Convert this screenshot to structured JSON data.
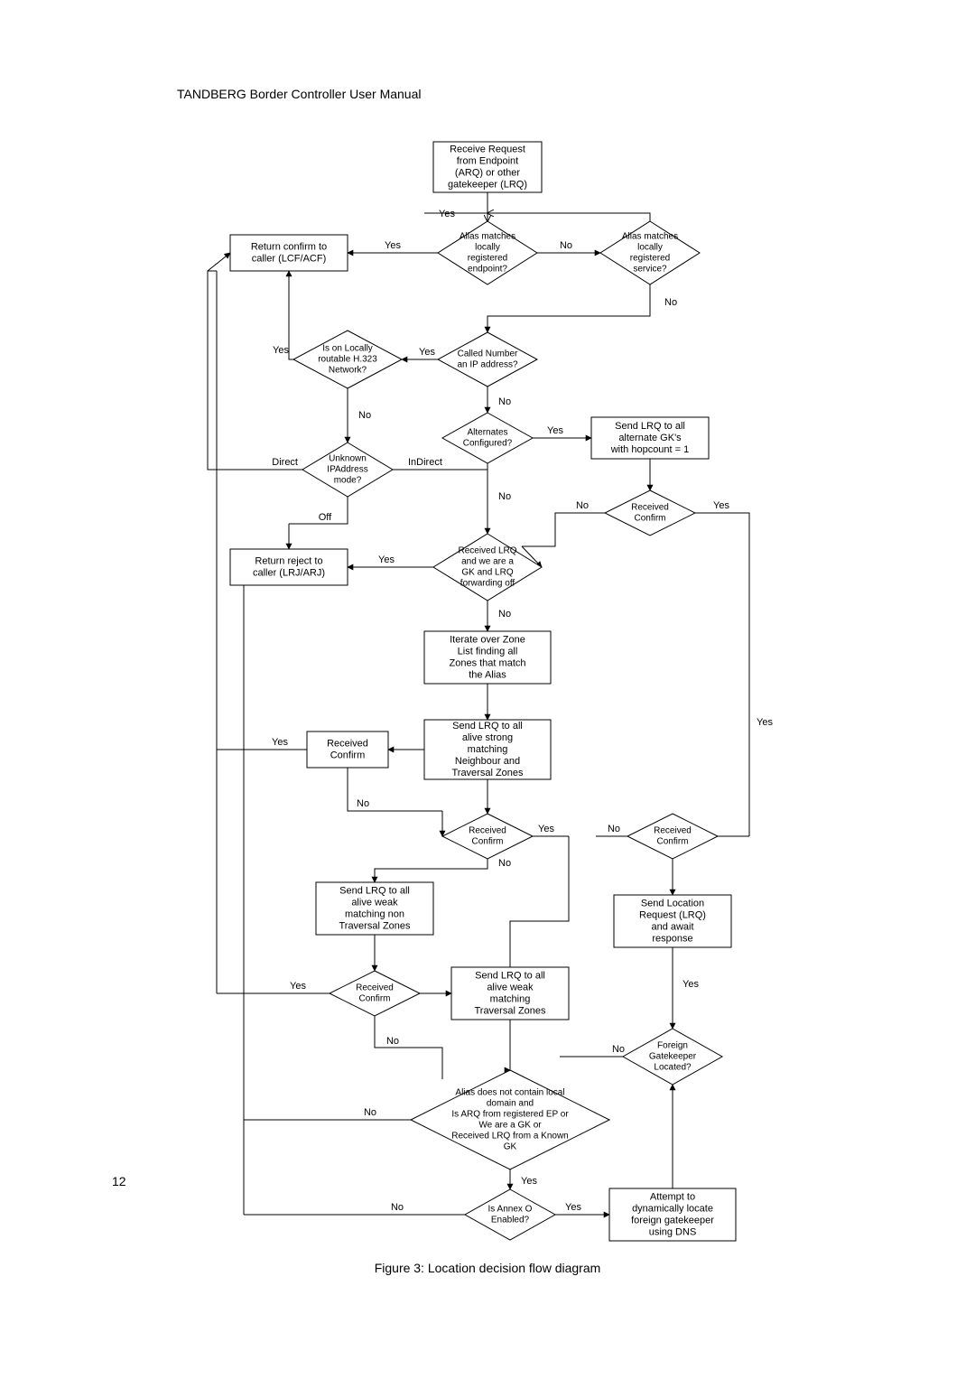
{
  "header": "TANDBERG Border Controller User Manual",
  "page_number": "12",
  "caption": "Figure 3: Location decision flow diagram",
  "labels": {
    "yes": "Yes",
    "no": "No",
    "off": "Off",
    "direct": "Direct",
    "indirect": "InDirect"
  },
  "nodes": {
    "start": [
      "Receive Request",
      "from Endpoint",
      "(ARQ) or other",
      "gatekeeper (LRQ)"
    ],
    "alias_local_ep": [
      "Alias matches",
      "locally",
      "registered",
      "endpoint?"
    ],
    "alias_local_svc": [
      "Alias matches",
      "locally",
      "registered",
      "service?"
    ],
    "return_confirm": [
      "Return confirm to",
      "caller (LCF/ACF)"
    ],
    "called_ip": [
      "Called Number",
      "an IP address?"
    ],
    "routable_net": [
      "Is on Locally",
      "routable H.323",
      "Network?"
    ],
    "alternates_cfg": [
      "Alternates",
      "Configured?"
    ],
    "send_alt": [
      "Send LRQ to all",
      "alternate GK's",
      "with hopcount = 1"
    ],
    "unknown_ip_mode": [
      "Unknown",
      "IPAddress",
      "mode?"
    ],
    "recv_confirm_alt": [
      "Received",
      "Confirm"
    ],
    "recv_lrq_gk": [
      "Received LRQ",
      "and we are a",
      "GK and LRQ",
      "forwarding off"
    ],
    "return_reject": [
      "Return reject to",
      "caller (LRJ/ARJ)"
    ],
    "iterate_zones": [
      "Iterate over Zone",
      "List finding all",
      "Zones that match",
      "the Alias"
    ],
    "send_strong": [
      "Send LRQ to all",
      "alive strong",
      "matching",
      "Neighbour and",
      "Traversal Zones"
    ],
    "recv_confirm_strong": [
      "Received",
      "Confirm"
    ],
    "recv_confirm_mid": [
      "Received",
      "Confirm"
    ],
    "send_weak_non_trav": [
      "Send LRQ to all",
      "alive weak",
      "matching non",
      "Traversal Zones"
    ],
    "recv_confirm_weak": [
      "Received",
      "Confirm"
    ],
    "send_weak_trav": [
      "Send LRQ to all",
      "alive weak",
      "matching",
      "Traversal Zones"
    ],
    "recv_confirm_right": [
      "Received",
      "Confirm"
    ],
    "send_loc_req": [
      "Send Location",
      "Request (LRQ)",
      "and await",
      "response"
    ],
    "foreign_gk": [
      "Foreign",
      "Gatekeeper",
      "Located?"
    ],
    "arq_check": [
      "Alias does not contain local",
      "domain and",
      "Is ARQ from registered EP or",
      "We are a GK or",
      "Received LRQ from a Known",
      "GK"
    ],
    "annex_o": [
      "Is Annex O",
      "Enabled?"
    ],
    "attempt_dns": [
      "Attempt to",
      "dynamically locate",
      "foreign gatekeeper",
      "using DNS"
    ]
  }
}
